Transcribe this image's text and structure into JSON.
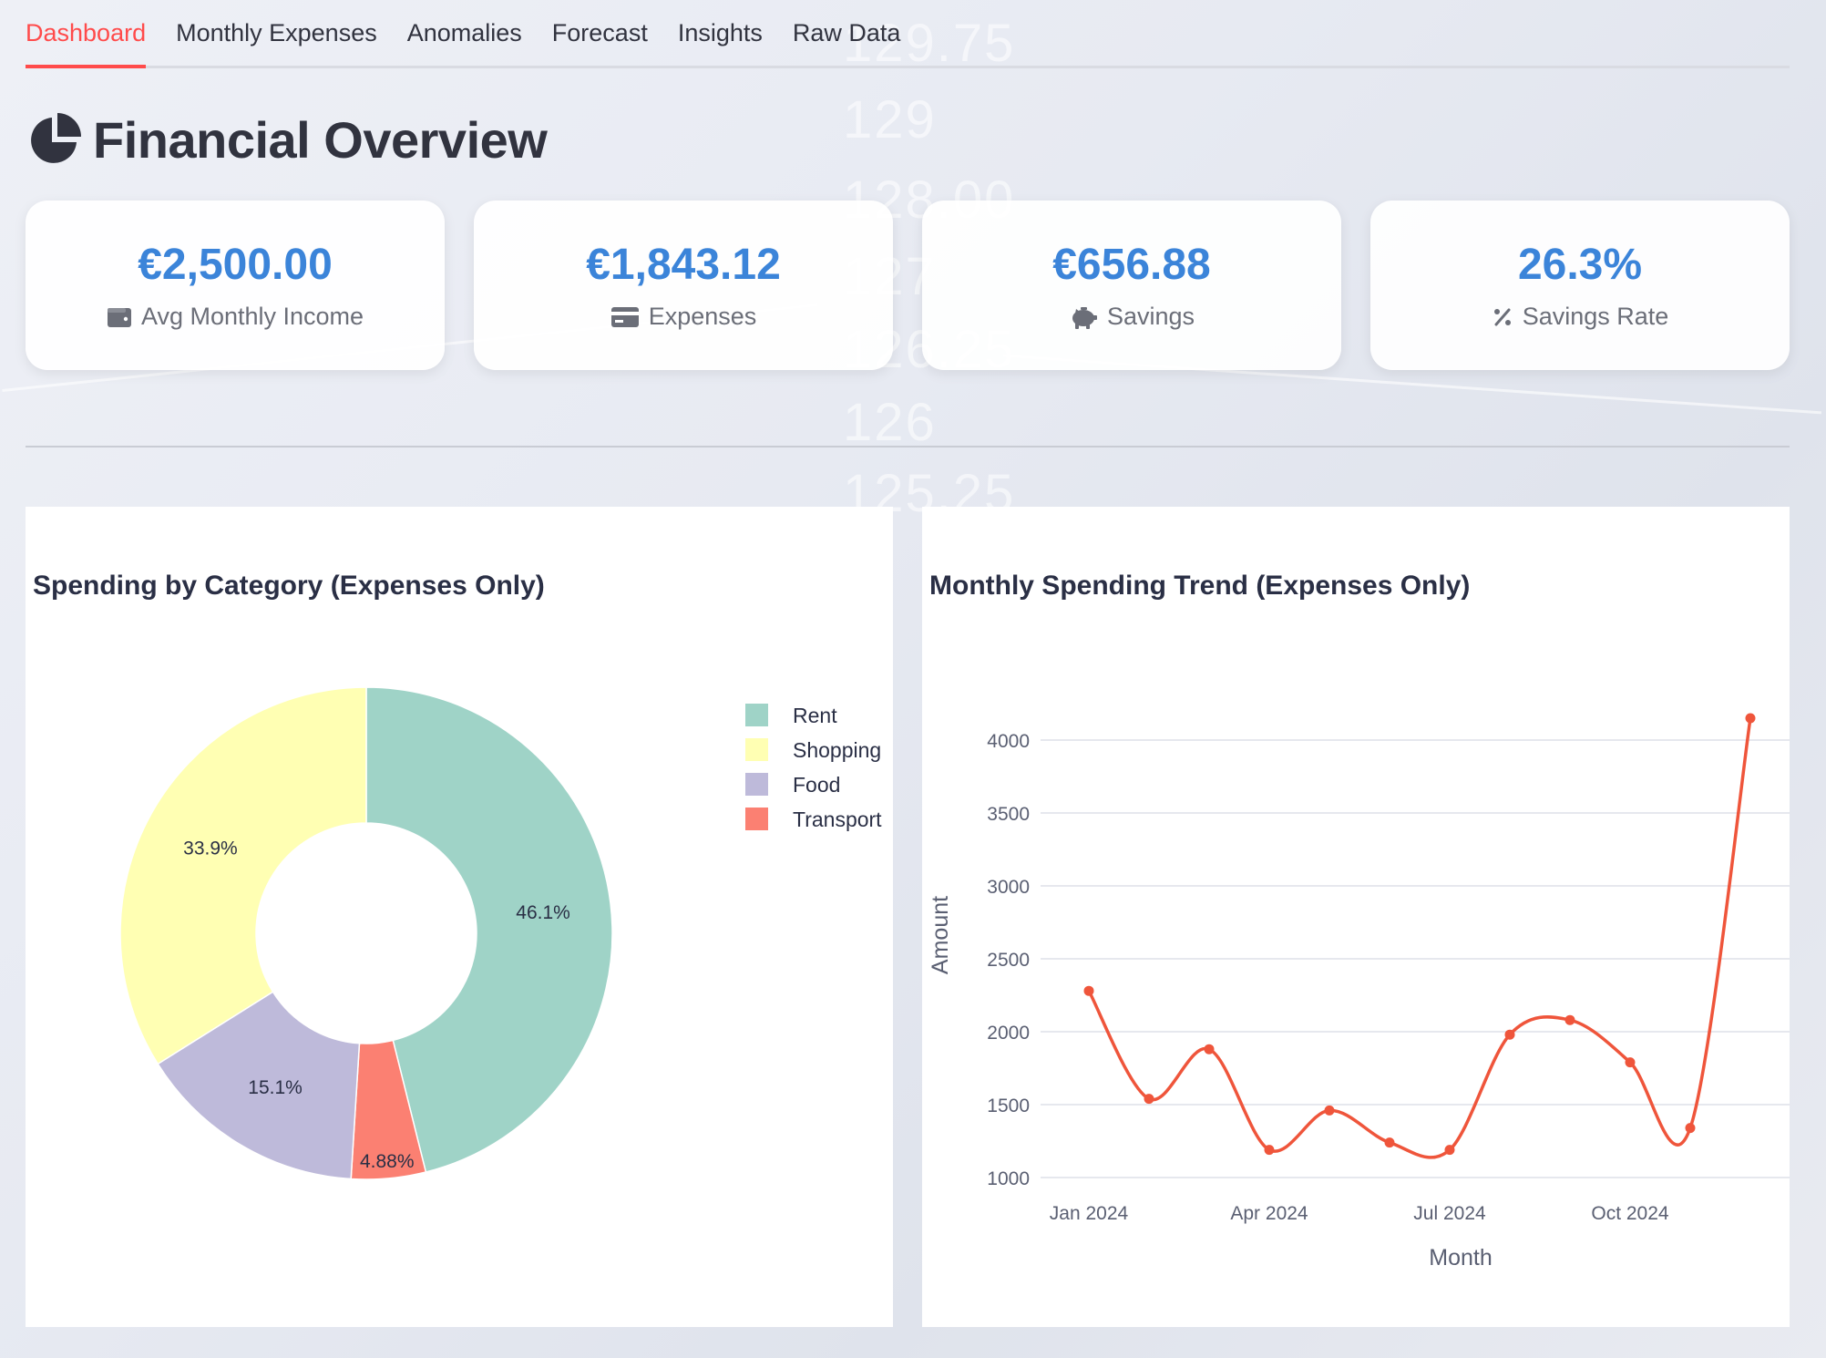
{
  "tabs": [
    {
      "label": "Dashboard",
      "active": true
    },
    {
      "label": "Monthly Expenses",
      "active": false
    },
    {
      "label": "Anomalies",
      "active": false
    },
    {
      "label": "Forecast",
      "active": false
    },
    {
      "label": "Insights",
      "active": false
    },
    {
      "label": "Raw Data",
      "active": false
    }
  ],
  "header": {
    "title": "Financial Overview",
    "icon": "pie-chart-icon"
  },
  "background_ticker": [
    "129.75",
    "129",
    "128.00",
    "127",
    "126.25",
    "126",
    "125.25"
  ],
  "metrics": [
    {
      "value": "€2,500.00",
      "label": "Avg Monthly Income",
      "icon": "wallet-icon"
    },
    {
      "value": "€1,843.12",
      "label": "Expenses",
      "icon": "credit-card-icon"
    },
    {
      "value": "€656.88",
      "label": "Savings",
      "icon": "piggy-bank-icon"
    },
    {
      "value": "26.3%",
      "label": "Savings Rate",
      "icon": "percent-icon"
    }
  ],
  "colors": {
    "accent": "#ff4b4b",
    "metric_value": "#3b84d9",
    "line": "#ef553b",
    "rent": "#9fd3c7",
    "shopping": "#ffffb3",
    "food": "#bebada",
    "transport": "#fb8072"
  },
  "pie_chart": {
    "title": "Spending by Category (Expenses Only)",
    "chart_data": {
      "type": "pie",
      "hole": true,
      "title": "Spending by Category (Expenses Only)",
      "legend_position": "right",
      "slices": [
        {
          "label": "Rent",
          "value": 46.1,
          "text": "46.1%",
          "color": "#9fd3c7"
        },
        {
          "label": "Transport",
          "value": 4.88,
          "text": "4.88%",
          "color": "#fb8072"
        },
        {
          "label": "Food",
          "value": 15.1,
          "text": "15.1%",
          "color": "#bebada"
        },
        {
          "label": "Shopping",
          "value": 33.9,
          "text": "33.9%",
          "color": "#ffffb3"
        }
      ],
      "legend": [
        "Rent",
        "Shopping",
        "Food",
        "Transport"
      ]
    }
  },
  "line_chart": {
    "title": "Monthly Spending Trend (Expenses Only)",
    "chart_data": {
      "type": "line",
      "title": "Monthly Spending Trend (Expenses Only)",
      "xlabel": "Month",
      "ylabel": "Amount",
      "x": [
        "2024-01",
        "2024-02",
        "2024-03",
        "2024-04",
        "2024-05",
        "2024-06",
        "2024-07",
        "2024-08",
        "2024-09",
        "2024-10",
        "2024-11",
        "2024-12"
      ],
      "x_ticks": [
        "Jan 2024",
        "Apr 2024",
        "Jul 2024",
        "Oct 2024"
      ],
      "y_ticks": [
        1000,
        1500,
        2000,
        2500,
        3000,
        3500,
        4000
      ],
      "ylim": [
        1000,
        4000
      ],
      "grid": true,
      "series": [
        {
          "values": [
            2280,
            1540,
            1880,
            1190,
            1460,
            1240,
            1190,
            1980,
            2080,
            1790,
            1340,
            4150
          ],
          "color": "#ef553b"
        }
      ]
    }
  }
}
